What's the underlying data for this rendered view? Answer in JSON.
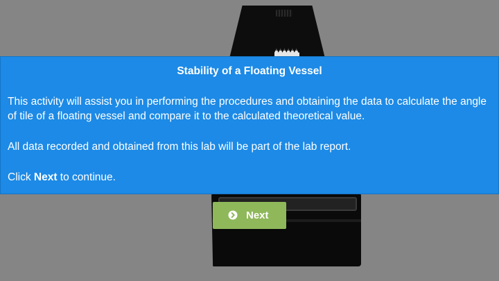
{
  "modal": {
    "title": "Stability of a Floating Vessel",
    "paragraph1": "This activity will assist you in performing the procedures and obtaining the data to calculate the angle of tile of a floating vessel and compare it to the calculated theoretical value.",
    "paragraph2": "All data recorded and obtained from this lab will be part of the lab report.",
    "paragraph3_prefix": "Click ",
    "paragraph3_bold": "Next",
    "paragraph3_suffix": " to continue."
  },
  "next_button": {
    "label": "Next",
    "icon": "arrow-right-circle-icon"
  },
  "colors": {
    "modal_background": "#1c8ae6",
    "overlay_background": "#858585",
    "button_background": "#8fb85a",
    "text": "#ffffff"
  }
}
